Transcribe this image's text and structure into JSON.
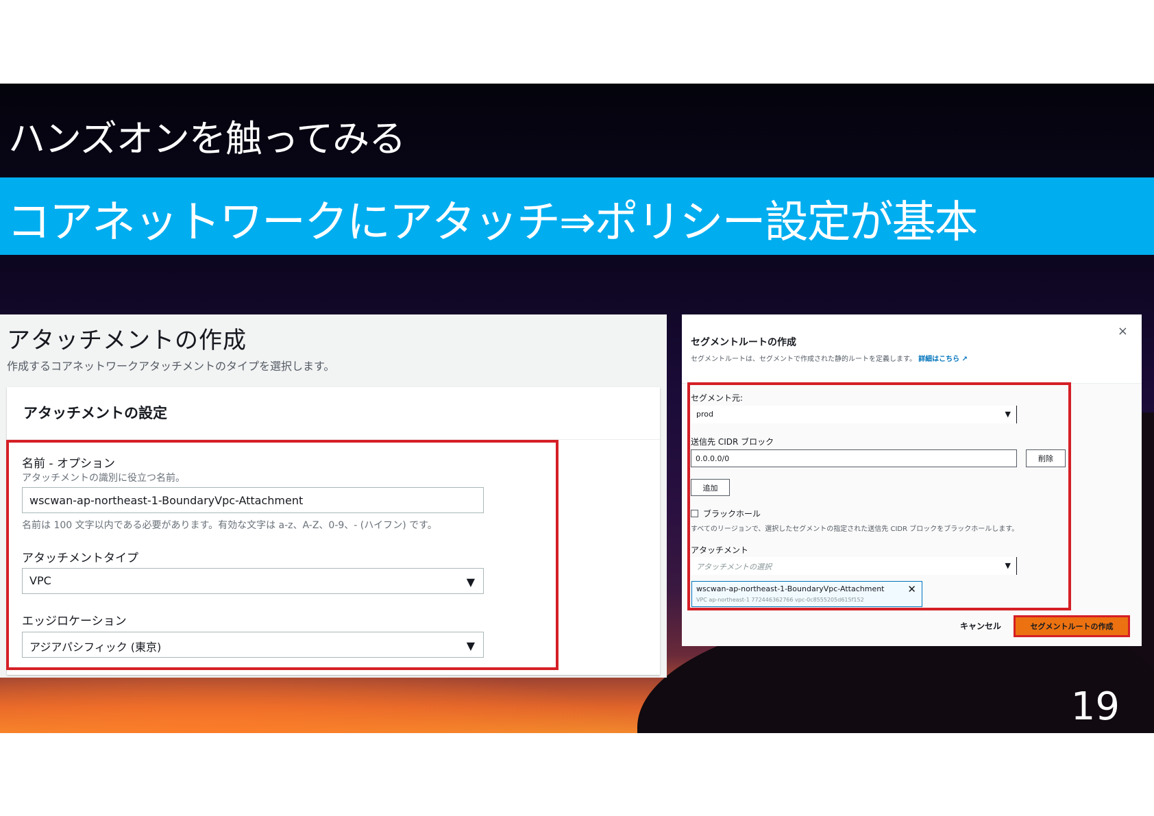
{
  "slide": {
    "title": "ハンズオンを触ってみる",
    "subtitle": "コアネットワークにアタッチ⇒ポリシー設定が基本",
    "page_number": "19"
  },
  "left_panel": {
    "title": "アタッチメントの作成",
    "description": "作成するコアネットワークアタッチメントのタイプを選択します。",
    "section_title": "アタッチメントの設定",
    "name_label": "名前 - オプション",
    "name_help": "アタッチメントの識別に役立つ名前。",
    "name_value": "wscwan-ap-northeast-1-BoundaryVpc-Attachment",
    "name_constraint": "名前は 100 文字以内である必要があります。有効な文字は a-z、A-Z、0-9、- (ハイフン) です。",
    "type_label": "アタッチメントタイプ",
    "type_value": "VPC",
    "edge_label": "エッジロケーション",
    "edge_value": "アジアパシフィック (東京)"
  },
  "modal": {
    "title": "セグメントルートの作成",
    "description": "セグメントルートは、セグメントで作成された静的ルートを定義します。",
    "learn_more": "詳細はこちら",
    "close_symbol": "×",
    "segment_label": "セグメント元:",
    "segment_value": "prod",
    "cidr_label": "送信先 CIDR ブロック",
    "cidr_value": "0.0.0.0/0",
    "remove_button": "削除",
    "add_button": "追加",
    "blackhole_label": "ブラックホール",
    "blackhole_help": "すべてのリージョンで、選択したセグメントの指定された送信先 CIDR ブロックをブラックホールします。",
    "attachment_label": "アタッチメント",
    "attachment_placeholder": "アタッチメントの選択",
    "token_name": "wscwan-ap-northeast-1-BoundaryVpc-Attachment",
    "token_meta": "VPC    ap-northeast-1    772446362766    vpc-0c8555205d615f152",
    "cancel_button": "キャンセル",
    "create_button": "セグメントルートの作成"
  },
  "colors": {
    "banner": "#00adef",
    "highlight_border": "#d51f26",
    "primary_button": "#ec7211",
    "link": "#0073bb"
  }
}
